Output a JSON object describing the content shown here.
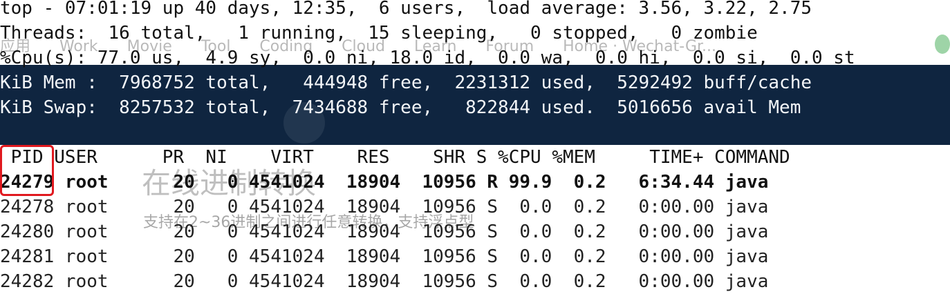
{
  "terminal": {
    "summary": {
      "top_line": "top - 07:01:19 up 40 days, 12:35,  6 users,  load average: 3.56, 3.22, 2.75",
      "threads_line": "Threads:  16 total,   1 running,  15 sleeping,   0 stopped,   0 zombie",
      "cpu_line": "%Cpu(s): 77.0 us,  4.9 sy,  0.0 ni, 18.0 id,  0.0 wa,  0.0 hi,  0.0 si,  0.0 st",
      "mem_line": "KiB Mem :  7968752 total,   444948 free,  2231312 used,  5292492 buff/cache",
      "swap_line": "KiB Swap:  8257532 total,  7434688 free,   822844 used.  5016656 avail Mem"
    },
    "table": {
      "header": " PID USER      PR  NI    VIRT    RES    SHR S %CPU %MEM     TIME+ COMMAND",
      "rows": [
        "24279 root      20   0 4541024  18904  10956 R 99.9  0.2   6:34.44 java",
        "24278 root      20   0 4541024  18904  10956 S  0.0  0.2   0:00.00 java",
        "24280 root      20   0 4541024  18904  10956 S  0.0  0.2   0:00.00 java",
        "24281 root      20   0 4541024  18904  10956 S  0.0  0.2   0:00.00 java",
        "24282 root      20   0 4541024  18904  10956 S  0.0  0.2   0:00.00 java"
      ]
    }
  },
  "background_page": {
    "bookmarks": "应用      Work      Movie      Tool      Coding      Cloud      Learn      Forum      Home · Wechat-Gr...",
    "title": "在线进制转换",
    "subtitle": "支持在2~36进制之间进行任意转换，支持浮点型"
  },
  "colors": {
    "dark_band": "#0f2540",
    "highlight": "#e0191f"
  }
}
